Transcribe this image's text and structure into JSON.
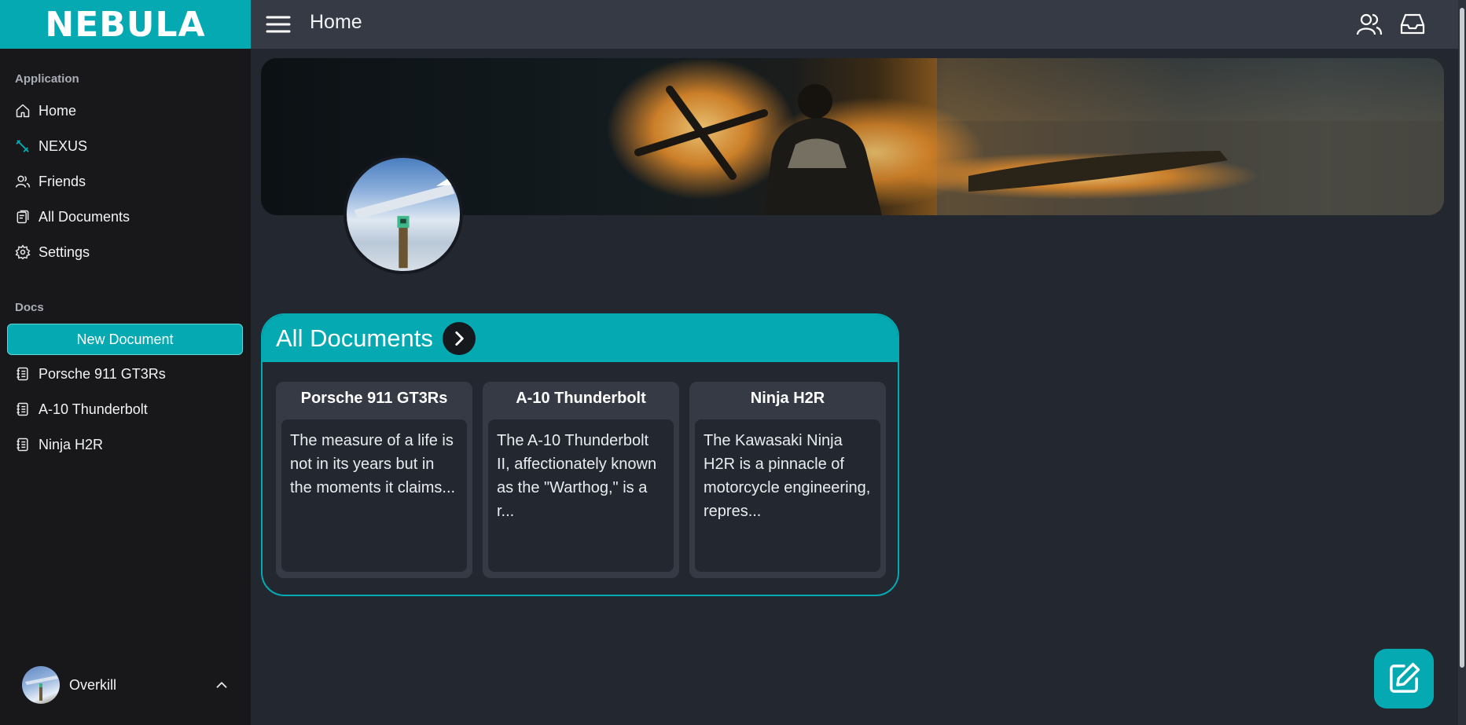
{
  "app": {
    "brand": "NEBULA"
  },
  "topbar": {
    "title": "Home"
  },
  "sidebar": {
    "application_label": "Application",
    "nav": [
      {
        "label": "Home",
        "icon": "home-icon"
      },
      {
        "label": "NEXUS",
        "icon": "nexus-icon"
      },
      {
        "label": "Friends",
        "icon": "friends-icon"
      },
      {
        "label": "All Documents",
        "icon": "documents-icon"
      },
      {
        "label": "Settings",
        "icon": "gear-icon"
      }
    ],
    "docs_label": "Docs",
    "new_document": "New Document",
    "docs": [
      {
        "label": "Porsche 911 GT3Rs",
        "icon": "notebook-icon"
      },
      {
        "label": "A-10 Thunderbolt",
        "icon": "notebook-icon"
      },
      {
        "label": "Ninja H2R",
        "icon": "notebook-icon"
      }
    ],
    "user": {
      "name": "Overkill"
    }
  },
  "documents_panel": {
    "title": "All Documents",
    "cards": [
      {
        "title": "Porsche 911 GT3Rs",
        "excerpt": "The measure of a life is not in its years but in the moments it claims..."
      },
      {
        "title": "A-10 Thunderbolt",
        "excerpt": "The A-10 Thunderbolt II, affectionately known as the \"Warthog,\" is a r..."
      },
      {
        "title": "Ninja H2R",
        "excerpt": "The Kawasaki Ninja H2R is a pinnacle of motorcycle engineering, repres..."
      }
    ]
  },
  "colors": {
    "accent": "#04a9b2",
    "sidebar_bg": "#18181b",
    "topbar_bg": "#363a45",
    "page_bg": "#232730"
  }
}
